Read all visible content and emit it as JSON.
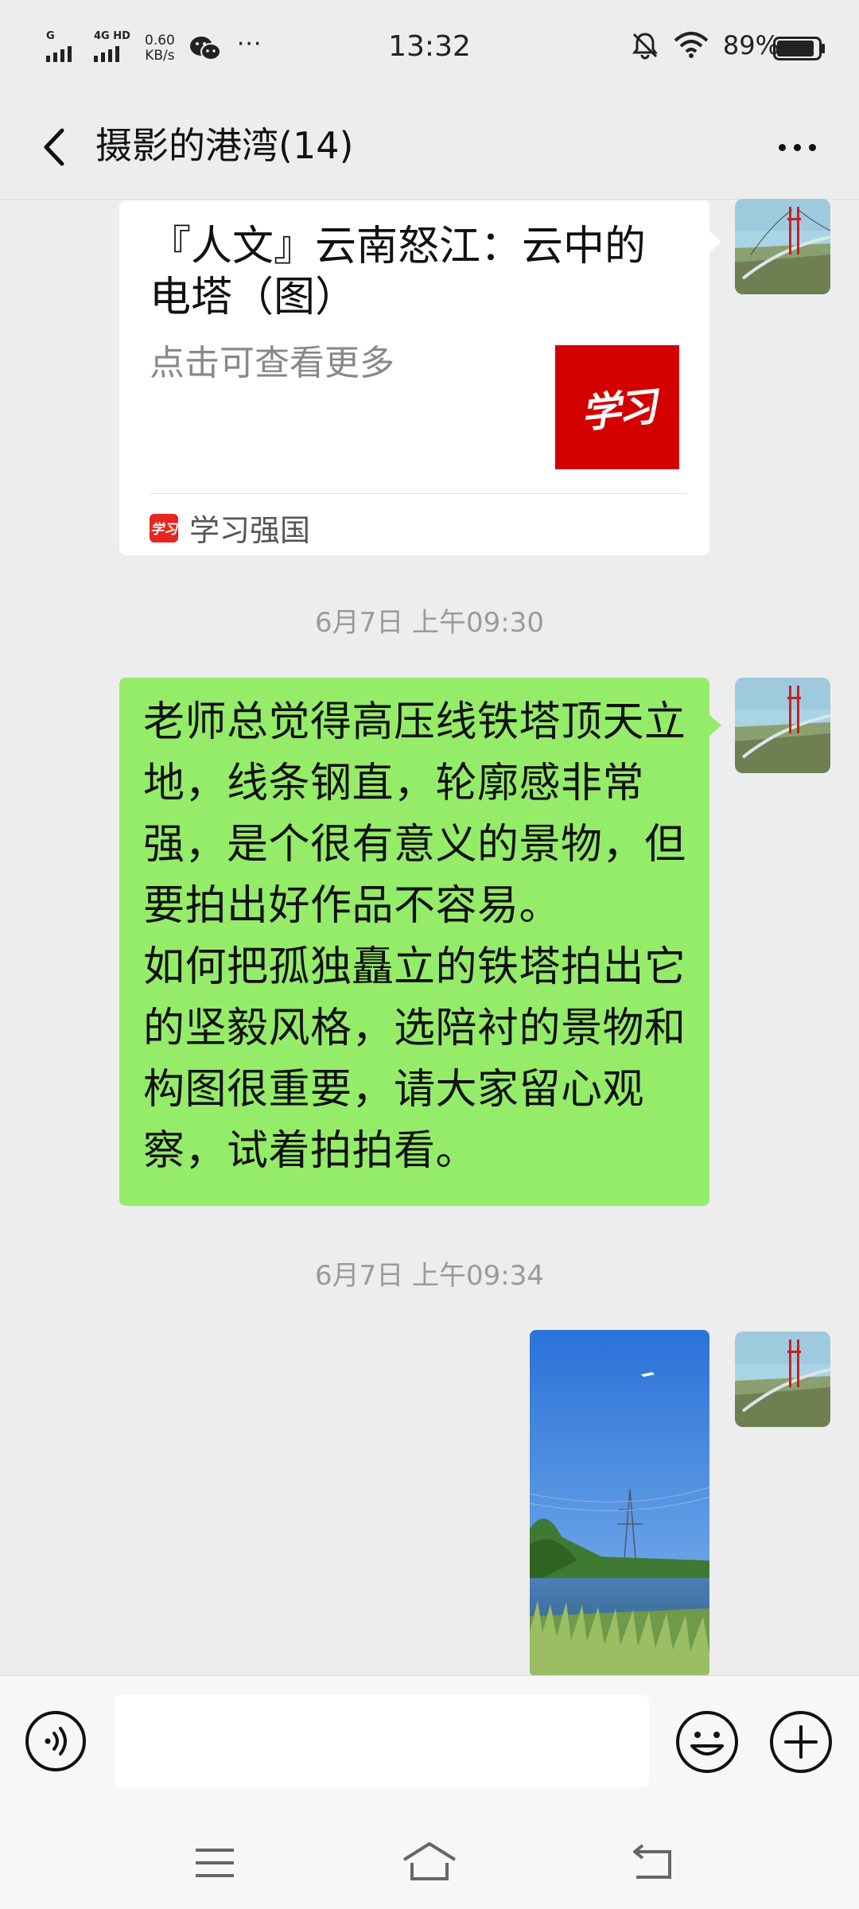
{
  "status_bar": {
    "signal1_label": "G",
    "signal2_label": "4G HD",
    "net_speed_value": "0.60",
    "net_speed_unit": "KB/s",
    "more": "···",
    "time": "13:32",
    "battery_percent": "89%",
    "battery_level": 0.89
  },
  "header": {
    "title": "摄影的港湾(14)"
  },
  "messages": {
    "card": {
      "title": "『人文』云南怒江：云中的电塔（图）",
      "desc": "点击可查看更多",
      "thumb_text": "学习",
      "source_logo_text": "学习",
      "source_name": "学习强国"
    },
    "timestamp1": "6月7日 上午09:30",
    "text_message": "老师总觉得高压线铁塔顶天立地，线条钢直，轮廓感非常强，是个很有意义的景物，但要拍出好作品不容易。\n如何把孤独矗立的铁塔拍出它的坚毅风格，选陪衬的景物和构图很重要，请大家留心观察，试着拍拍看。",
    "timestamp2": "6月7日 上午09:34"
  },
  "icons": {
    "back": "chevron-left-icon",
    "more": "ellipsis-icon",
    "voice": "voice-icon",
    "emoji": "smiley-icon",
    "plus": "plus-circle-icon",
    "nav_menu": "menu-icon",
    "nav_home": "home-icon",
    "nav_back": "back-arrow-icon"
  },
  "colors": {
    "background": "#ededed",
    "my_bubble": "#95ec69",
    "thumb_red": "#d40000"
  }
}
